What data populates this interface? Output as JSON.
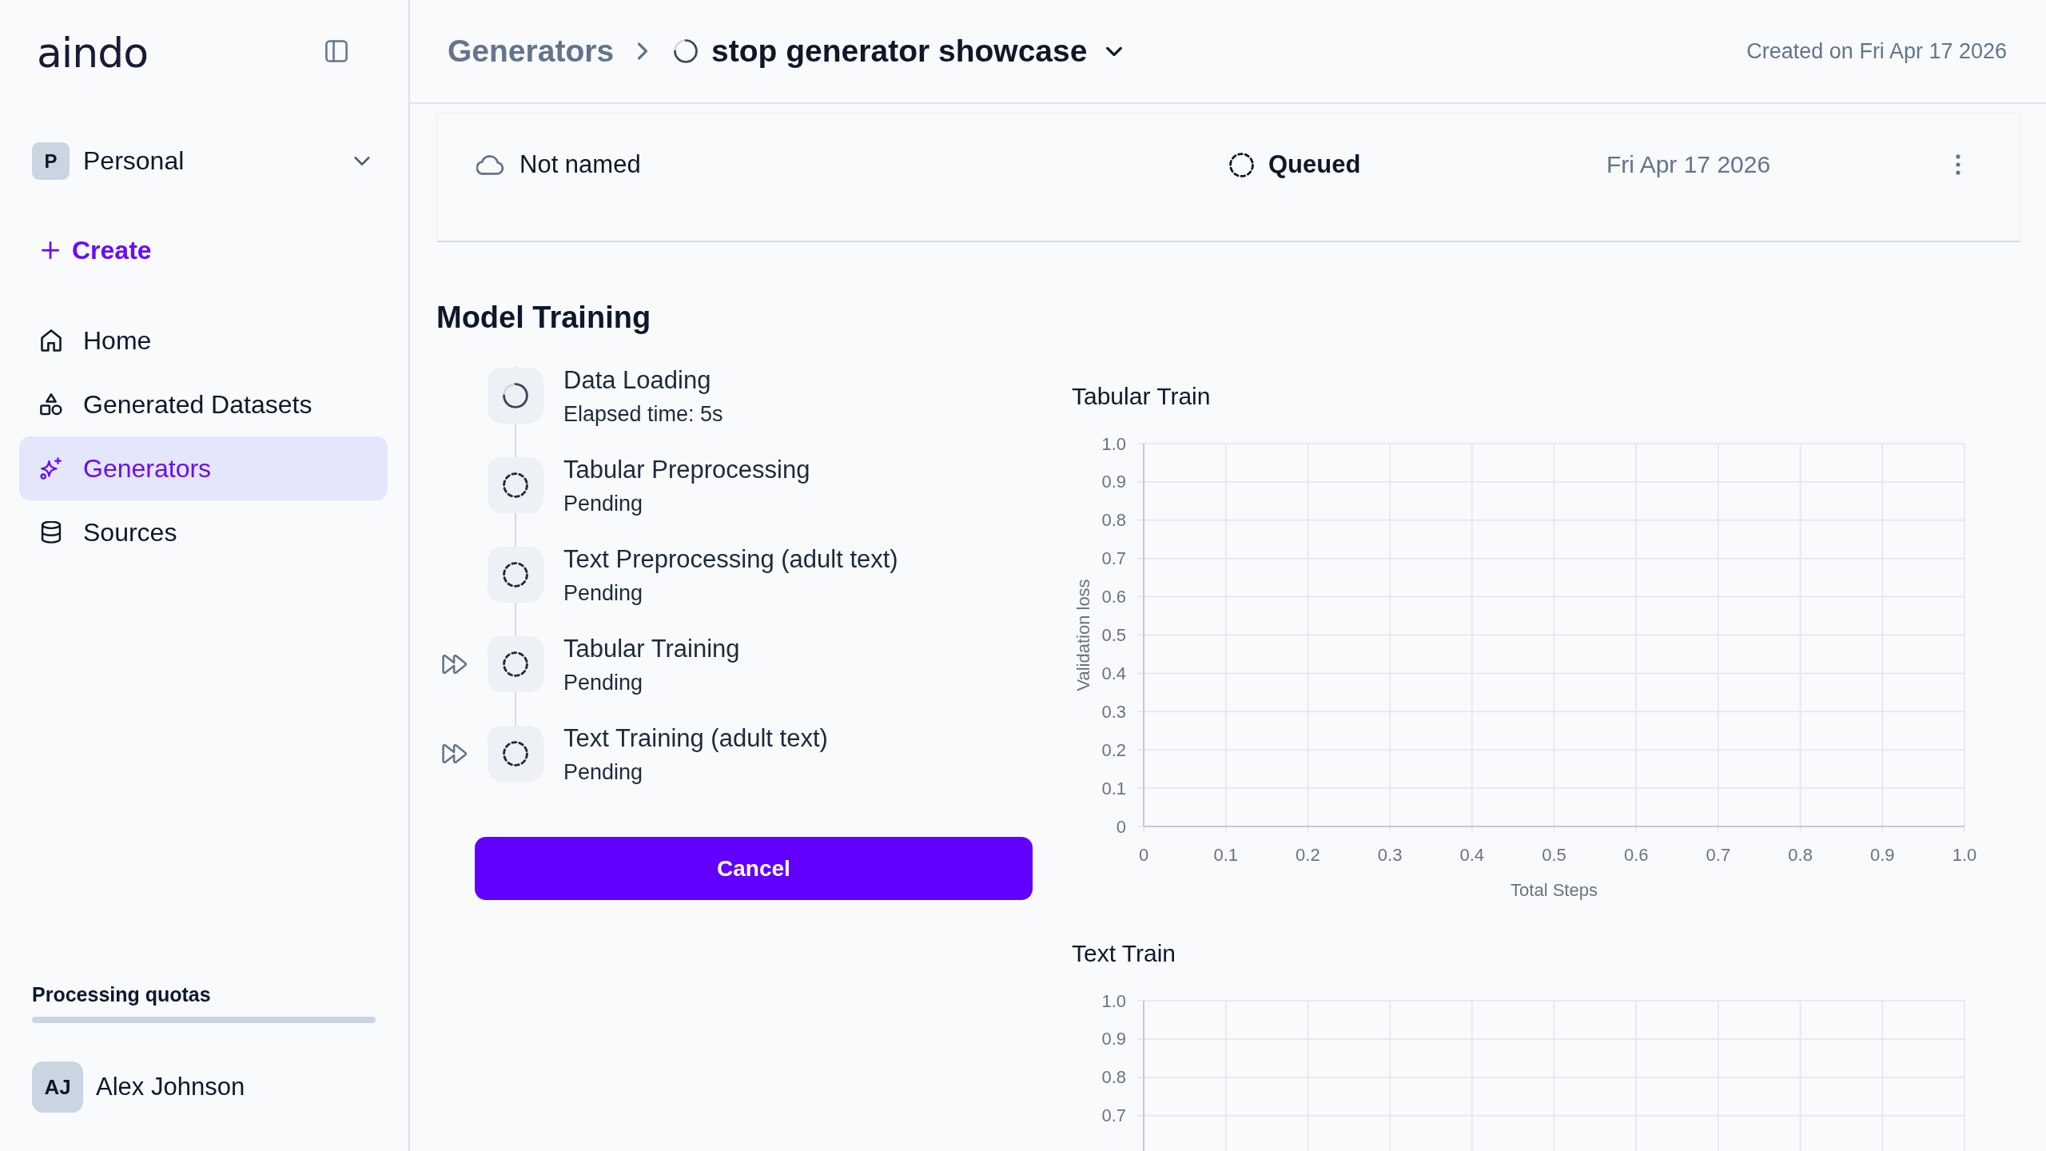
{
  "sidebar": {
    "logo": "aindo",
    "workspace": {
      "initial": "P",
      "name": "Personal"
    },
    "create": "Create",
    "nav": [
      {
        "label": "Home",
        "selected": false
      },
      {
        "label": "Generated Datasets",
        "selected": false
      },
      {
        "label": "Generators",
        "selected": true
      },
      {
        "label": "Sources",
        "selected": false
      }
    ],
    "quotas": {
      "label": "Processing quotas"
    },
    "user": {
      "initials": "AJ",
      "name": "Alex Johnson"
    }
  },
  "header": {
    "breadcrumb": "Generators",
    "running": true,
    "title": "stop generator showcase",
    "created": "Created on Fri Apr 17 2026"
  },
  "generator_row": {
    "name": "Not named",
    "running": false,
    "status_label": "Queued",
    "date": "Fri Apr 17 2026"
  },
  "model_training": {
    "title": "Model Training",
    "steps": [
      {
        "title": "Data Loading",
        "detail": "Elapsed time: 5s",
        "running": true,
        "fast_forward": false
      },
      {
        "title": "Tabular Preprocessing",
        "detail": "Pending",
        "running": false,
        "fast_forward": false
      },
      {
        "title": "Text Preprocessing (adult text)",
        "detail": "Pending",
        "running": false,
        "fast_forward": false
      },
      {
        "title": "Tabular Training",
        "detail": "Pending",
        "running": false,
        "fast_forward": true
      },
      {
        "title": "Text Training (adult text)",
        "detail": "Pending",
        "running": false,
        "fast_forward": true
      }
    ],
    "cancel": "Cancel"
  },
  "charts": [
    {
      "chart_data": {
        "type": "line",
        "title": "Tabular Train",
        "xlabel": "Total Steps",
        "ylabel": "Validation loss",
        "xlim": [
          0,
          1
        ],
        "ylim": [
          0,
          1
        ],
        "xticks": [
          0,
          0.1,
          0.2,
          0.3,
          0.4,
          0.5,
          0.6,
          0.7,
          0.8,
          0.9,
          {
            "value": 1,
            "label": "1.0"
          }
        ],
        "yticks": [
          0,
          0.1,
          0.2,
          0.3,
          0.4,
          0.5,
          0.6,
          0.7,
          0.8,
          0.9,
          {
            "value": 1,
            "label": "1.0"
          }
        ],
        "grid": true
      }
    },
    {
      "chart_data": {
        "type": "line",
        "title": "Text Train",
        "xlim": [
          0,
          1
        ],
        "ylim": [
          0,
          1
        ],
        "yticks": [
          0.7,
          0.8,
          0.9,
          {
            "value": 1,
            "label": "1.0"
          }
        ],
        "grid": true
      }
    }
  ]
}
